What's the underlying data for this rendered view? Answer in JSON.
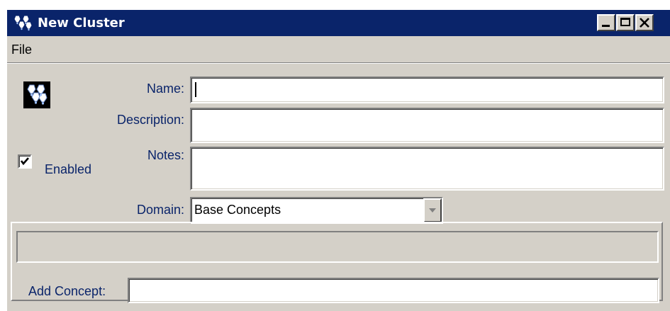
{
  "window": {
    "title": "New Cluster",
    "icon": "cluster-icon",
    "title_bar_color": "#0a246a",
    "controls": [
      "minimize-icon",
      "maximize-icon",
      "close-icon"
    ]
  },
  "menu": {
    "file_label": "File"
  },
  "form": {
    "name_label": "Name:",
    "name_value": "",
    "description_label": "Description:",
    "description_value": "",
    "notes_label": "Notes:",
    "notes_value": "",
    "domain_label": "Domain:",
    "domain_value": "Base Concepts",
    "enabled_label": "Enabled",
    "enabled_checked": true
  },
  "concepts": {
    "add_label": "Add Concept:",
    "add_value": ""
  },
  "colors": {
    "label_text": "#0a246a",
    "window_bg": "#d4d0c8"
  }
}
